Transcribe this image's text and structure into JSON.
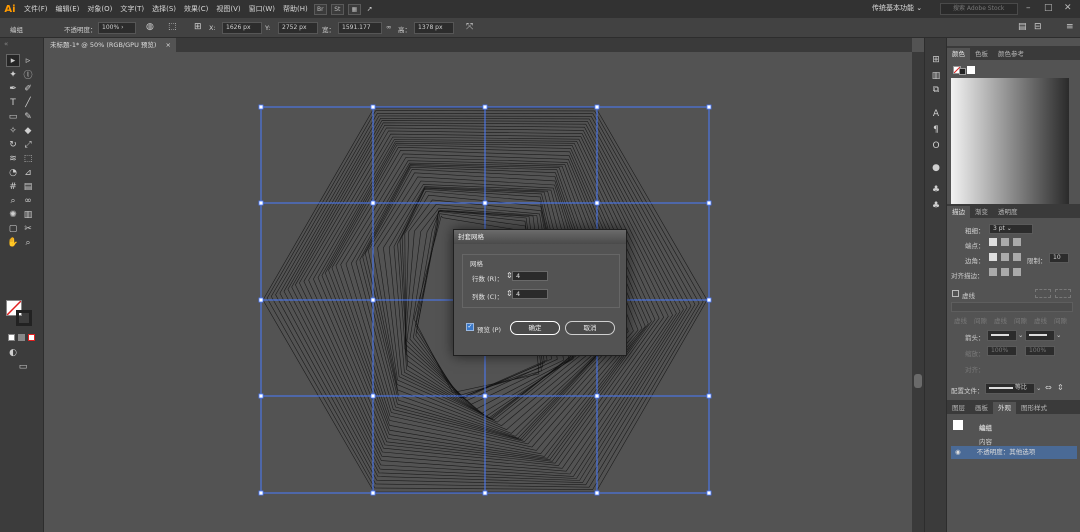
{
  "app": {
    "logo": "Ai",
    "workspace": "传统基本功能",
    "stock_placeholder": "搜索 Adobe Stock"
  },
  "menu": [
    "文件(F)",
    "编辑(E)",
    "对象(O)",
    "文字(T)",
    "选择(S)",
    "效果(C)",
    "视图(V)",
    "窗口(W)",
    "帮助(H)"
  ],
  "menu_icons": [
    "Br",
    "St"
  ],
  "control": {
    "selection": "编组",
    "opacity_label": "不透明度：",
    "opacity_value": "100%",
    "x_label": "X:",
    "x_value": "1626 px",
    "y_label": "Y:",
    "y_value": "2752 px",
    "w_label": "宽：",
    "w_value": "1591.177",
    "h_label": "高：",
    "h_value": "1378 px"
  },
  "document": {
    "tab": "未标题-1* @ 50% (RGB/GPU 预览)",
    "close": "×"
  },
  "dialog": {
    "title": "封套网格",
    "group": "网格",
    "rows_label": "行数 (R)：",
    "rows_value": "4",
    "cols_label": "列数 (C)：",
    "cols_value": "4",
    "preview_label": "预览 (P)",
    "ok": "确定",
    "cancel": "取消"
  },
  "color_panel": {
    "tabs": [
      "颜色",
      "色板",
      "颜色参考"
    ]
  },
  "stroke_panel": {
    "tabs": [
      "描边",
      "渐变",
      "透明度"
    ],
    "weight_label": "粗细：",
    "weight_value": "3 pt",
    "cap_label": "端点：",
    "corner_label": "边角：",
    "limit_label": "限制：",
    "limit_value": "10",
    "align_label": "对齐描边：",
    "dashed_label": "虚线",
    "dash_labels": [
      "虚线",
      "间隙",
      "虚线",
      "间隙",
      "虚线",
      "间隙"
    ],
    "arrow_label": "箭头：",
    "scale_label": "缩放：",
    "scale_1": "100%",
    "scale_2": "100%",
    "align2_label": "对齐：",
    "profile_label": "配置文件：",
    "profile_value": "等比"
  },
  "appearance_panel": {
    "tabs": [
      "图层",
      "画板",
      "外观",
      "图形样式"
    ],
    "group": "编组",
    "content": "内容",
    "opacity_row": "不透明度：其他选项"
  },
  "icons": {
    "tools": [
      "selection-icon",
      "direct-selection-icon",
      "magic-wand-icon",
      "lasso-icon",
      "pen-icon",
      "curvature-icon",
      "type-icon",
      "line-icon",
      "rectangle-icon",
      "paintbrush-icon",
      "shaper-icon",
      "eraser-icon",
      "rotate-icon",
      "scale-icon",
      "width-icon",
      "free-transform-icon",
      "shape-builder-icon",
      "perspective-icon",
      "mesh-icon",
      "gradient-icon",
      "eyedropper-icon",
      "blend-icon",
      "symbol-sprayer-icon",
      "graph-icon",
      "artboard-icon",
      "slice-icon",
      "hand-icon",
      "zoom-icon"
    ]
  },
  "colors": {
    "accent": "#4a6a96",
    "selection_blue": "#4a7bff",
    "logo": "#ff9a00"
  }
}
